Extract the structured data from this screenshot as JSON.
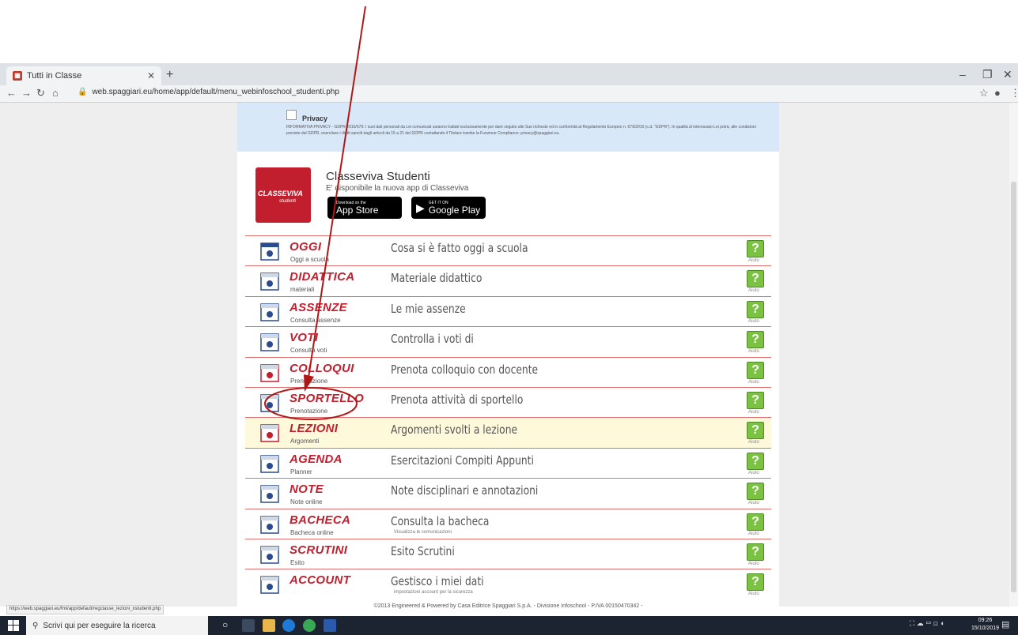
{
  "browser": {
    "tab_title": "Tutti in Classe",
    "url": "web.spaggiari.eu/home/app/default/menu_webinfoschool_studenti.php",
    "status_url": "https://web.spaggiari.eu/fml/app/default/regclasse_lezioni_xstudenti.php"
  },
  "privacy": {
    "title": "Privacy",
    "text": "INFORMATIVA PRIVACY - GDPR 2016/679: I suoi dati personali da Lei comunicati saranno trattati esclusivamente per dare seguito alle Sue richieste ed in conformità al Regolamento Europeo n. 679/2016 (c.d. \"GDPR\"). In qualità di interessato Lei potrà, alle condizioni previste dal GDPR, esercitare i diritti sanciti dagli articoli da 15 a 21 del GDPR contattando il Titolare tramite la Funzione Compliance: privacy@spaggiari.eu."
  },
  "promo": {
    "logo_text": "CLASSEVIVA",
    "logo_sub": "studenti",
    "title": "Classeviva Studenti",
    "subtitle": "E' disponibile la nuova app di Classeviva",
    "appstore_small": "Download on the",
    "appstore_big": "App Store",
    "gplay_small": "GET IT ON",
    "gplay_big": "Google Play"
  },
  "menu": [
    {
      "name": "OGGI",
      "sub": "Oggi a scuola",
      "desc": "Cosa si è fatto oggi a scuola",
      "desc2": "",
      "icon": "calendar-15-icon",
      "highlight": false
    },
    {
      "name": "DIDATTICA",
      "sub": "materiali",
      "desc": "Materiale didattico",
      "desc2": "",
      "icon": "board-icon",
      "highlight": false
    },
    {
      "name": "ASSENZE",
      "sub": "Consulta assenze",
      "desc": "Le mie assenze",
      "desc2": "",
      "icon": "grid-icon",
      "highlight": false
    },
    {
      "name": "VOTI",
      "sub": "Consulta voti",
      "desc": "Controlla i voti di",
      "desc2": "",
      "icon": "grade-icon",
      "highlight": false
    },
    {
      "name": "COLLOQUI",
      "sub": "Prenotazione",
      "desc": "Prenota colloquio con docente",
      "desc2": "",
      "icon": "people-icon",
      "highlight": false
    },
    {
      "name": "SPORTELLO",
      "sub": "Prenotazione",
      "desc": "Prenota attività di sportello",
      "desc2": "",
      "icon": "person-desk-icon",
      "highlight": false
    },
    {
      "name": "LEZIONI",
      "sub": "Argomenti",
      "desc": "Argomenti svolti a lezione",
      "desc2": "",
      "icon": "teacher-icon",
      "highlight": true
    },
    {
      "name": "AGENDA",
      "sub": "Planner",
      "desc": "Esercitazioni Compiti Appunti",
      "desc2": "",
      "icon": "agenda-icon",
      "highlight": false
    },
    {
      "name": "NOTE",
      "sub": "Note online",
      "desc": "Note disciplinari e annotazioni",
      "desc2": "",
      "icon": "note-person-icon",
      "highlight": false
    },
    {
      "name": "BACHECA",
      "sub": "Bacheca online",
      "desc": "Consulta la bacheca",
      "desc2": "Visualizza le comunicazioni",
      "icon": "board-notes-icon",
      "highlight": false
    },
    {
      "name": "SCRUTINI",
      "sub": "Esito",
      "desc": "Esito Scrutini",
      "desc2": "",
      "icon": "scrutini-icon",
      "highlight": false
    },
    {
      "name": "ACCOUNT",
      "sub": "",
      "desc": "Gestisco i miei dati",
      "desc2": "impostazioni account per la sicurezza",
      "icon": "account-card-icon",
      "highlight": false
    }
  ],
  "help_label": "Aiuto",
  "help_glyph": "?",
  "footer": {
    "text": "©2013 Engineered & Powered by Casa Editrice Spaggiari S.p.A. - Divisione Infoschool - P.IVA 00150470342 -"
  },
  "taskbar": {
    "search_placeholder": "Scrivi qui per eseguire la ricerca",
    "time": "09:26",
    "date": "15/10/2019"
  },
  "colors": {
    "brand_red": "#c21f2e",
    "help_green": "#7cc242",
    "annotation_red": "#b01818"
  }
}
